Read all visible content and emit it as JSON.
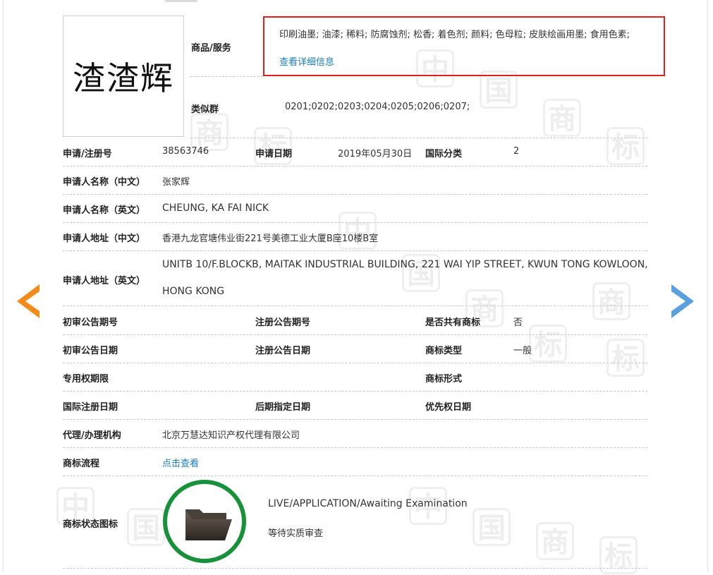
{
  "trademark": {
    "name": "渣渣辉"
  },
  "goods": {
    "label": "商品/服务",
    "items": "印刷油墨; 油漆; 稀料; 防腐蚀剂; 松香; 着色剂; 颜料; 色母粒; 皮肤绘画用墨; 食用色素;",
    "detail_link": "查看详细信息"
  },
  "similar_group": {
    "label": "类似群",
    "value": "0201;0202;0203;0204;0205;0206;0207;"
  },
  "app_no": {
    "label": "申请/注册号",
    "value": "38563746"
  },
  "app_date": {
    "label": "申请日期",
    "value": "2019年05月30日"
  },
  "intl_class": {
    "label": "国际分类",
    "value": "2"
  },
  "applicant_cn": {
    "label": "申请人名称（中文）",
    "value": "张家辉"
  },
  "applicant_en": {
    "label": "申请人名称（英文）",
    "value": "CHEUNG, KA FAI NICK"
  },
  "address_cn": {
    "label": "申请人地址（中文）",
    "value": "香港九龙官塘伟业街221号美德工业大厦B座10楼B室"
  },
  "address_en": {
    "label": "申请人地址（英文）",
    "line1": "UNITB 10/F.BLOCKB, MAITAK INDUSTRIAL BUILDING, 221 WAI YIP STREET, KWUN TONG KOWLOON,",
    "line2": "HONG KONG"
  },
  "prelim_no": {
    "label": "初审公告期号",
    "value": ""
  },
  "reg_no": {
    "label": "注册公告期号",
    "value": ""
  },
  "shared": {
    "label": "是否共有商标",
    "value": "否"
  },
  "prelim_date": {
    "label": "初审公告日期",
    "value": ""
  },
  "reg_date": {
    "label": "注册公告日期",
    "value": ""
  },
  "tm_type": {
    "label": "商标类型",
    "value": "一般"
  },
  "exclusive_period": {
    "label": "专用权期限",
    "value": ""
  },
  "tm_form": {
    "label": "商标形式",
    "value": ""
  },
  "intl_reg_date": {
    "label": "国际注册日期",
    "value": ""
  },
  "later_date": {
    "label": "后期指定日期",
    "value": ""
  },
  "priority_date": {
    "label": "优先权日期",
    "value": ""
  },
  "agent": {
    "label": "代理/办理机构",
    "value": "北京万慧达知识产权代理有限公司"
  },
  "process": {
    "label": "商标流程",
    "link": "点击查看"
  },
  "status": {
    "label": "商标状态图标",
    "en": "LIVE/APPLICATION/Awaiting Examination",
    "cn": "等待实质审查"
  },
  "watermark": {
    "chars": [
      "中",
      "国",
      "商",
      "标"
    ]
  },
  "colors": {
    "accent_red": "#e0201e",
    "link_blue": "#1a7fc1",
    "status_green": "#17923a",
    "arrow_orange": "#f28a1c",
    "arrow_blue": "#5aa0dc"
  },
  "icons": [
    "arrow-left-icon",
    "arrow-right-icon",
    "folder-icon"
  ]
}
